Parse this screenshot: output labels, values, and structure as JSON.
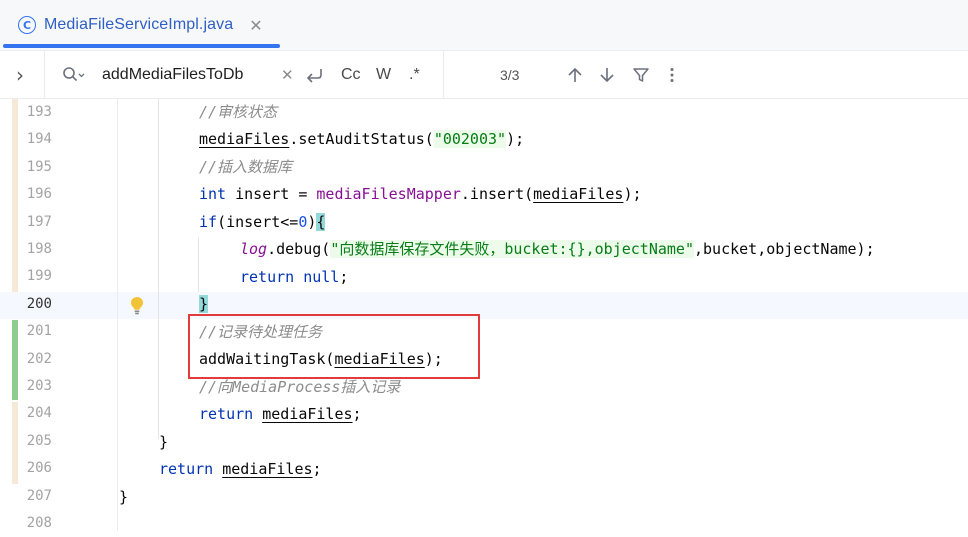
{
  "tab": {
    "file_name": "MediaFileServiceImpl.java",
    "icon": "class-icon",
    "icon_glyph": "C",
    "close_glyph": "✕"
  },
  "find": {
    "expand_glyph": "›",
    "query": "addMediaFilesToDb",
    "clear_glyph": "✕",
    "match_case_label": "Cc",
    "words_label": "W",
    "regex_label": ".*",
    "match_count": "3/3"
  },
  "gutter": {
    "line_numbers": [
      "193",
      "194",
      "195",
      "196",
      "197",
      "198",
      "199",
      "200",
      "201",
      "202",
      "203",
      "204",
      "205",
      "206",
      "207",
      "208"
    ],
    "current_line": "200"
  },
  "code": {
    "l193": "//审核状态",
    "l194_a": "mediaFiles",
    "l194_b": ".setAuditStatus(",
    "l194_c": "\"002003\"",
    "l194_d": ");",
    "l195": "//插入数据库",
    "l196_kw": "int",
    "l196_b": " insert = ",
    "l196_c": "mediaFilesMapper",
    "l196_d": ".insert(",
    "l196_e": "mediaFiles",
    "l196_f": ");",
    "l197_kw": "if",
    "l197_b": "(insert<=",
    "l197_c": "0",
    "l197_d": ")",
    "l197_e": "{",
    "l198_a": "log",
    "l198_b": ".debug(",
    "l198_c": "\"向数据库保存文件失败，bucket:{},objectName\"",
    "l198_d": ",bucket,objectName);",
    "l199_kw": "return",
    "l199_b": " ",
    "l199_c": "null",
    "l199_d": ";",
    "l200": "}",
    "l201": "//记录待处理任务",
    "l202_a": "addWaitingTask(",
    "l202_b": "mediaFiles",
    "l202_c": ");",
    "l203": "//向MediaProcess插入记录",
    "l204_kw": "return",
    "l204_b": " ",
    "l204_c": "mediaFiles",
    "l204_d": ";",
    "l205": "}",
    "l206_kw": "return",
    "l206_b": " ",
    "l206_c": "mediaFiles",
    "l206_d": ";",
    "l207": "}"
  },
  "colors": {
    "accent": "#3574f0",
    "vcs_modified": "#f6e9d8",
    "vcs_added": "#8fcc8f",
    "highlight_box": "#e23b3b"
  }
}
